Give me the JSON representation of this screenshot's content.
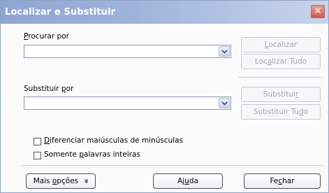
{
  "window": {
    "title": "Localizar e Substituir",
    "close_glyph": "✕"
  },
  "search": {
    "label_u": "P",
    "label_rest": "rocurar por",
    "value": ""
  },
  "replace": {
    "label_pre": "Substituir ",
    "label_u": "p",
    "label_rest": "or",
    "value": ""
  },
  "buttons": {
    "find": {
      "pre": "",
      "u": "L",
      "post": "ocalizar"
    },
    "find_all": {
      "pre": "Loc",
      "u": "a",
      "post": "lizar Tudo"
    },
    "replace": {
      "pre": "Substitui",
      "u": "r",
      "post": ""
    },
    "replace_all": {
      "pre": "Substituir Tu",
      "u": "d",
      "post": "o"
    },
    "more_options": {
      "pre": "Mais ",
      "u": "o",
      "post": "pções",
      "chevron": "»"
    },
    "help": {
      "pre": "Aj",
      "u": "u",
      "post": "da"
    },
    "close": {
      "pre": "Fe",
      "u": "c",
      "post": "har"
    }
  },
  "options": {
    "match_case": {
      "u": "D",
      "rest": "iferenciar maiúsculas de minúsculas",
      "checked": false
    },
    "whole_words": {
      "pre": "Somente ",
      "u": "p",
      "post": "alavras inteiras",
      "checked": false
    }
  },
  "colors": {
    "title_bar": "#9fb3da",
    "close_button": "#cc5a4e"
  }
}
